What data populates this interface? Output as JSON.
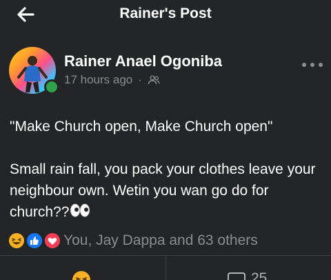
{
  "header": {
    "title": "Rainer's Post",
    "back_icon": "arrow-left-icon"
  },
  "post": {
    "author": "Rainer Anael Ogoniba",
    "time": "17 hours ago",
    "separator": "·",
    "audience_icon": "friends-icon",
    "online": true,
    "text_lines": [
      "\"Make Church open, Make Church open\"",
      "Small rain fall, you pack your clothes leave your neighbour own. Wetin you wan go do for church??"
    ],
    "text_emoji": "eyes-emoji"
  },
  "reactions": {
    "icons": [
      "haha-icon",
      "like-icon",
      "love-icon"
    ],
    "summary": "You, Jay Dappa and 63 others"
  },
  "actions": {
    "react_icon": "haha-icon",
    "comment_icon": "comment-icon",
    "comment_count": "25"
  },
  "colors": {
    "background": "#242526",
    "text": "#ffffff",
    "muted": "#8a8d91",
    "like": "#1877f2",
    "love": "#f33e58",
    "haha": "#f7b125",
    "online": "#31a24c"
  }
}
